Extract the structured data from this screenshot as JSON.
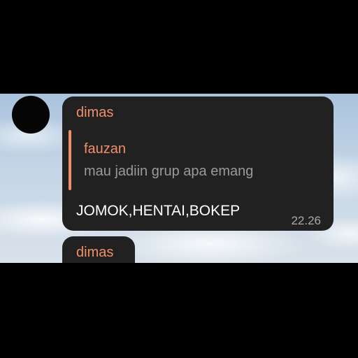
{
  "colors": {
    "accent": "#f0906a",
    "bubble": "#212121",
    "frame": "#000000"
  },
  "message1": {
    "sender": "dimas",
    "reply": {
      "name": "fauzan",
      "text": "mau jadiin grup apa emang"
    },
    "text": "JOMOK,HENTAI,BOKEP",
    "time": "22.26"
  },
  "message2": {
    "sender": "dimas"
  }
}
